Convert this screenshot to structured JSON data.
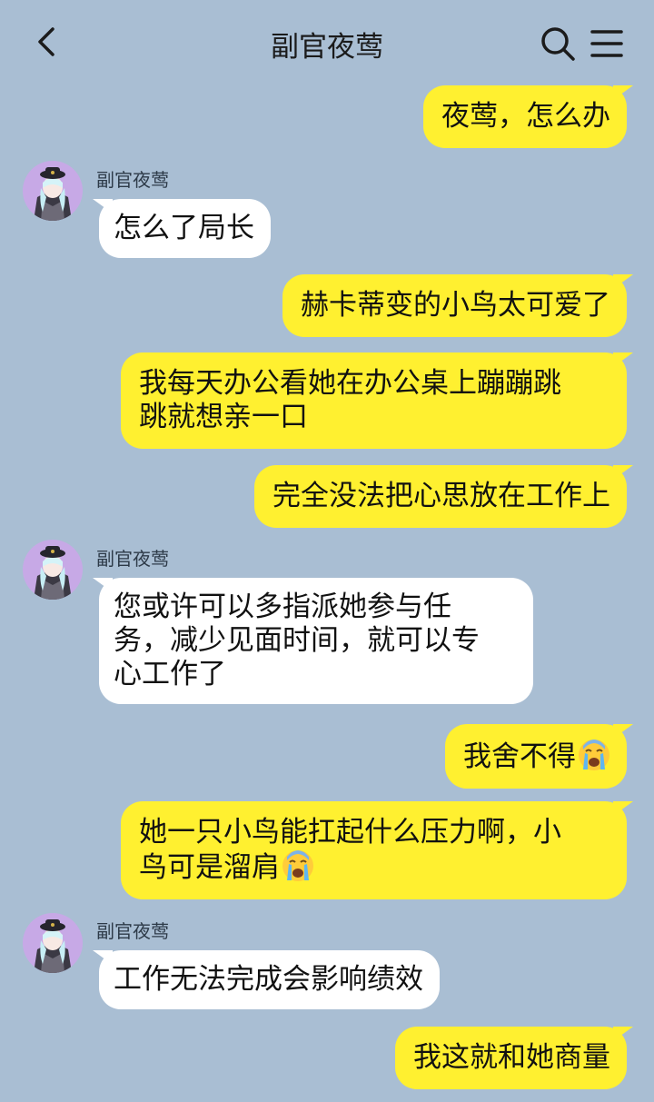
{
  "header": {
    "title": "副官夜莺",
    "back_icon": "chevron-left-icon",
    "search_icon": "search-icon",
    "menu_icon": "menu-icon"
  },
  "colors": {
    "background": "#a9bed3",
    "outgoing_bubble": "#fff030",
    "incoming_bubble": "#ffffff"
  },
  "messages": [
    {
      "from": "me",
      "text": "夜莺，怎么办"
    },
    {
      "from": "contact",
      "sender": "副官夜莺",
      "text": "怎么了局长"
    },
    {
      "from": "me",
      "text": "赫卡蒂变的小鸟太可爱了"
    },
    {
      "from": "me",
      "lines": [
        "我每天办公看她在办公桌上蹦蹦跳",
        "跳就想亲一口"
      ]
    },
    {
      "from": "me",
      "text": "完全没法把心思放在工作上"
    },
    {
      "from": "contact",
      "sender": "副官夜莺",
      "lines": [
        "您或许可以多指派她参与任",
        "务，减少见面时间，就可以专",
        "心工作了"
      ]
    },
    {
      "from": "me",
      "text": "我舍不得",
      "emoji": "crying-face-emoji"
    },
    {
      "from": "me",
      "lines": [
        "她一只小鸟能扛起什么压力啊，小",
        "鸟可是溜肩"
      ],
      "emoji": "crying-face-emoji"
    },
    {
      "from": "contact",
      "sender": "副官夜莺",
      "text": "工作无法完成会影响绩效"
    },
    {
      "from": "me",
      "text": "我这就和她商量"
    }
  ]
}
